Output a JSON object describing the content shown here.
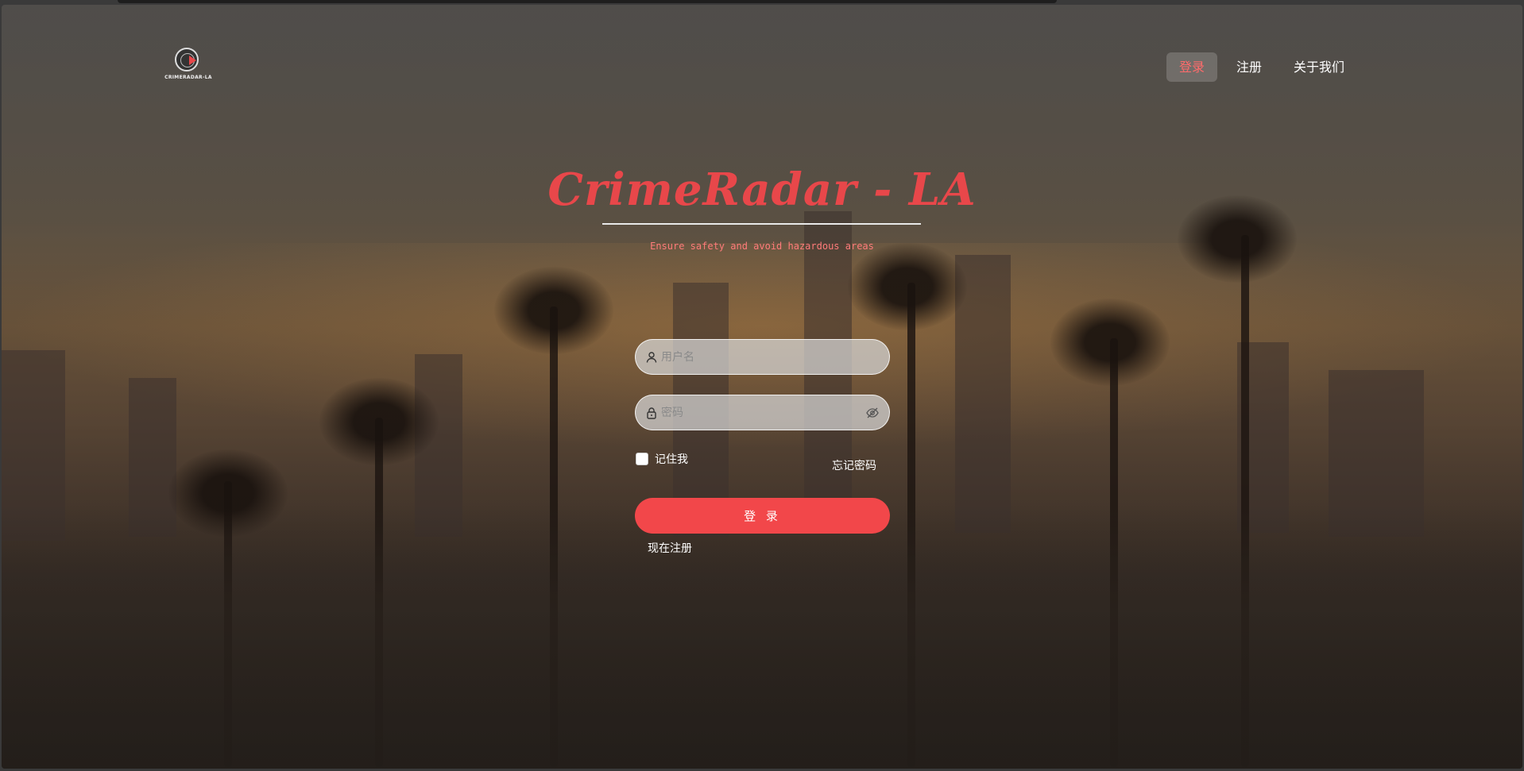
{
  "brand": {
    "logo_text": "CRIMERADAR-LA",
    "title": "CrimeRadar - LA",
    "subtitle": "Ensure safety and avoid hazardous areas"
  },
  "nav": {
    "items": [
      {
        "label": "登录",
        "active": true
      },
      {
        "label": "注册",
        "active": false
      },
      {
        "label": "关于我们",
        "active": false
      }
    ]
  },
  "form": {
    "username_placeholder": "用户名",
    "password_placeholder": "密码",
    "username_value": "",
    "password_value": "",
    "remember_label": "记住我",
    "remember_checked": false,
    "forgot_label": "忘记密码",
    "login_label": "登 录",
    "register_label": "现在注册"
  },
  "colors": {
    "accent": "#f2474a",
    "title": "#e8474a",
    "subtitle": "#ff7b7b",
    "nav_active_text": "#ff6b6b"
  },
  "icons": {
    "username": "user-icon",
    "password": "lock-icon",
    "toggle_password": "eye-off-icon"
  }
}
